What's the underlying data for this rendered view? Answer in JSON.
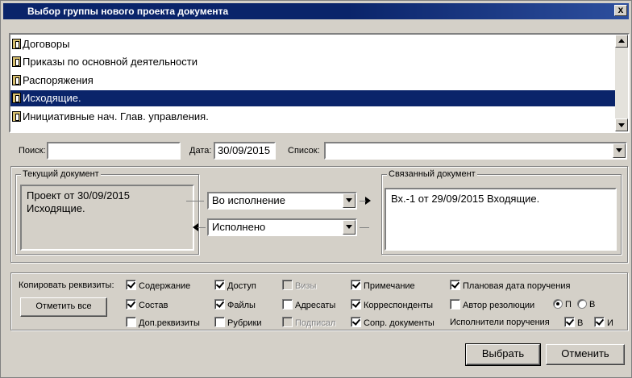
{
  "window": {
    "title": "Выбор группы нового проекта документа",
    "close_label": "x"
  },
  "groups_list": {
    "items": [
      {
        "label": "Договоры",
        "selected": false
      },
      {
        "label": "Приказы по основной деятельности",
        "selected": false
      },
      {
        "label": "Распоряжения",
        "selected": false
      },
      {
        "label": "Исходящие.",
        "selected": true
      },
      {
        "label": "Инициативные нач. Глав. управления.",
        "selected": false
      }
    ]
  },
  "filters": {
    "search_label": "Поиск:",
    "search_value": "",
    "date_label": "Дата:",
    "date_value": "30/09/2015",
    "list_label": "Список:",
    "list_value": ""
  },
  "current_doc": {
    "legend": "Текущий документ",
    "line1": "Проект от 30/09/2015",
    "line2": "Исходящие."
  },
  "link": {
    "forward_value": "Во исполнение",
    "backward_value": "Исполнено"
  },
  "linked_doc": {
    "legend": "Связанный документ",
    "text": "Вх.-1 от 29/09/2015 Входящие."
  },
  "copy": {
    "label": "Копировать реквизиты:",
    "mark_all_button": "Отметить все",
    "checkboxes": {
      "content": {
        "label": "Содержание",
        "checked": true
      },
      "composition": {
        "label": "Состав",
        "checked": true
      },
      "extra": {
        "label": "Доп.реквизиты",
        "checked": false
      },
      "access": {
        "label": "Доступ",
        "checked": true
      },
      "files": {
        "label": "Файлы",
        "checked": true
      },
      "rubrics": {
        "label": "Рубрики",
        "checked": false
      },
      "visas": {
        "label": "Визы",
        "checked": false
      },
      "addressees": {
        "label": "Адресаты",
        "checked": false
      },
      "signed": {
        "label": "Подписал",
        "checked": false
      },
      "note": {
        "label": "Примечание",
        "checked": true
      },
      "correspondents": {
        "label": "Корреспонденты",
        "checked": true
      },
      "related_docs": {
        "label": "Сопр. документы",
        "checked": true
      },
      "planned_date": {
        "label": "Плановая дата поручения",
        "checked": true
      },
      "resolution_author": {
        "label": "Автор резолюции",
        "checked": false
      }
    },
    "author_radio": {
      "p_label": "П",
      "v_label": "В",
      "selected": "П"
    },
    "executors_label": "Исполнители поручения",
    "executors": {
      "b_label": "В",
      "b_checked": true,
      "i_label": "И",
      "i_checked": true
    }
  },
  "buttons": {
    "select": "Выбрать",
    "cancel": "Отменить"
  }
}
